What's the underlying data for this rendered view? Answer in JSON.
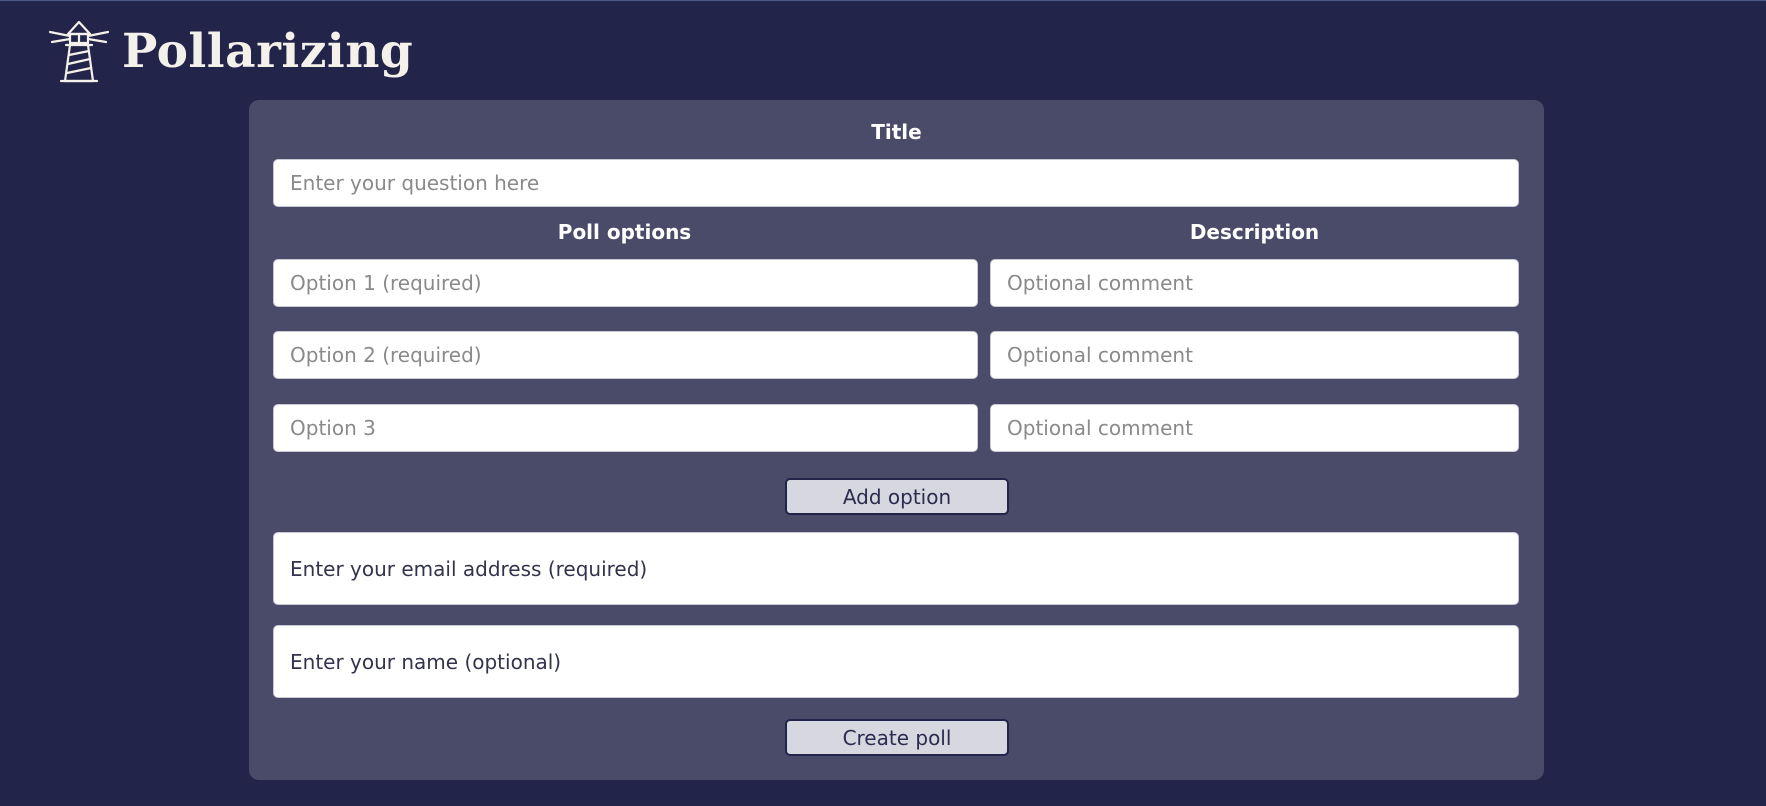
{
  "app": {
    "name": "Pollarizing",
    "logo_icon": "lighthouse-icon"
  },
  "form": {
    "title_label": "Title",
    "title_placeholder": "Enter your question here",
    "options_label": "Poll options",
    "description_label": "Description",
    "options": [
      {
        "placeholder": "Option 1 (required)",
        "comment_placeholder": "Optional comment"
      },
      {
        "placeholder": "Option 2 (required)",
        "comment_placeholder": "Optional comment"
      },
      {
        "placeholder": "Option 3",
        "comment_placeholder": "Optional comment"
      }
    ],
    "add_option_label": "Add option",
    "email_placeholder": "Enter your email address (required)",
    "name_placeholder": "Enter your name (optional)",
    "create_label": "Create poll"
  },
  "colors": {
    "background": "#23244a",
    "panel": "#4a4a69",
    "button": "#d7d7df"
  }
}
